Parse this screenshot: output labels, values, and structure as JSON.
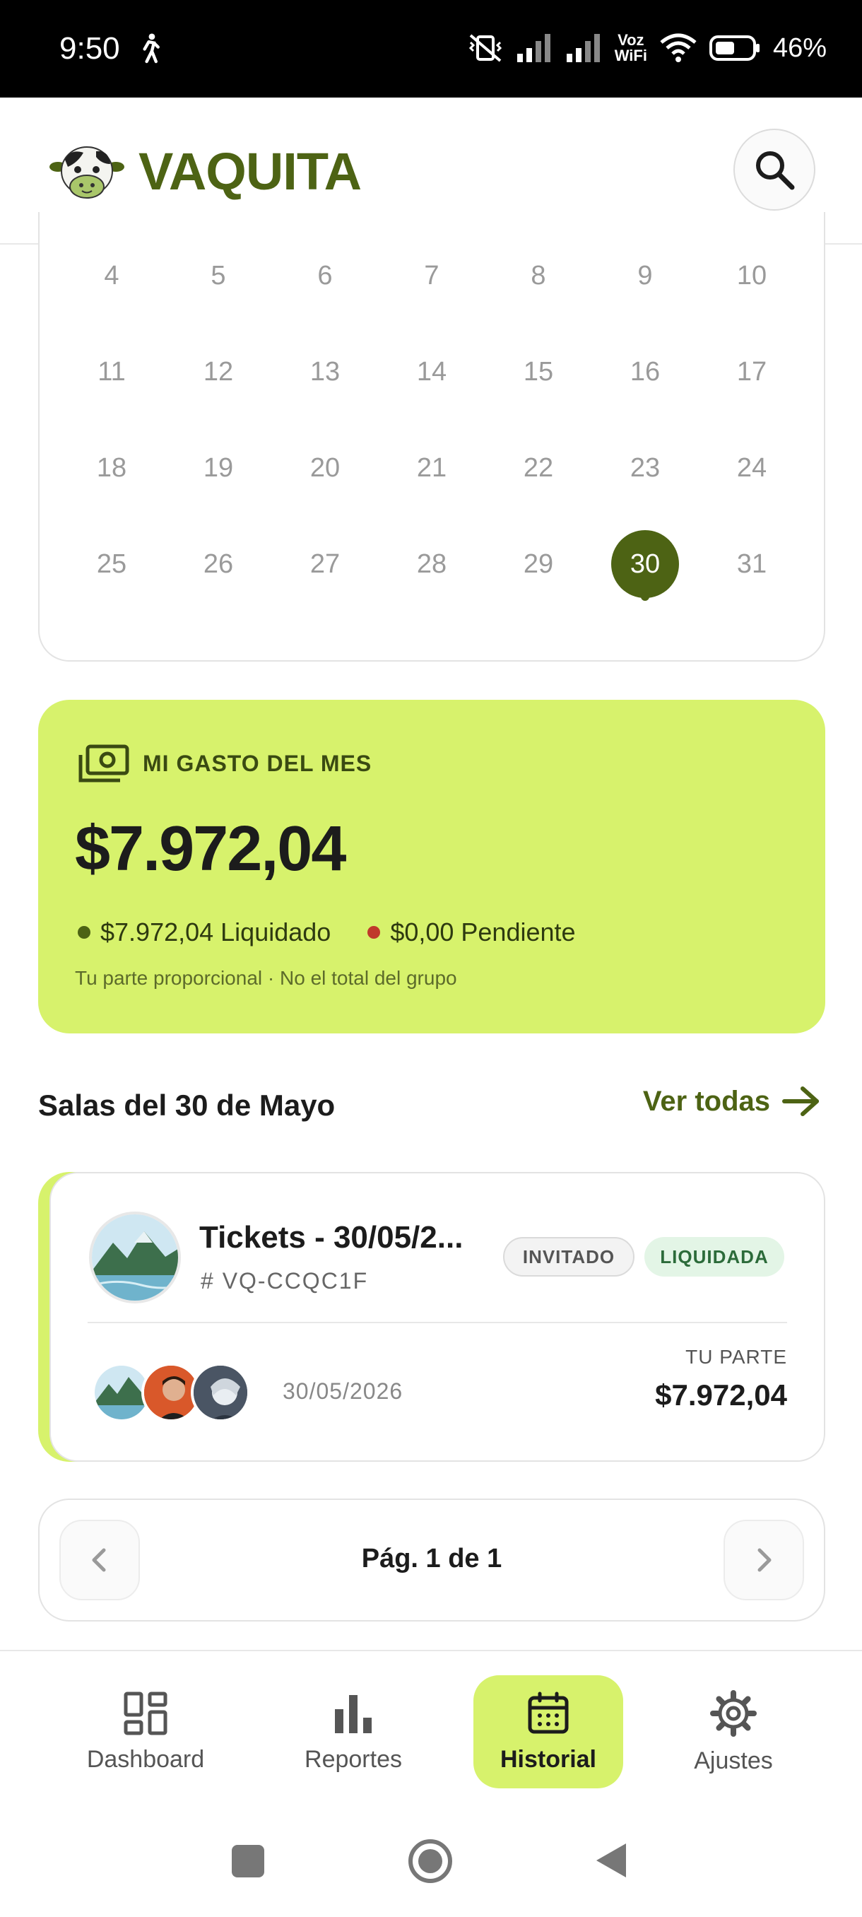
{
  "status_bar": {
    "time": "9:50",
    "network_label_top": "Voz",
    "network_label_bottom": "WiFi",
    "battery": "46%"
  },
  "app": {
    "name": "VAQUITA",
    "brand_color": "#4d6314",
    "accent_color": "#d7f26c"
  },
  "calendar": {
    "rows": [
      [
        "4",
        "5",
        "6",
        "7",
        "8",
        "9",
        "10"
      ],
      [
        "11",
        "12",
        "13",
        "14",
        "15",
        "16",
        "17"
      ],
      [
        "18",
        "19",
        "20",
        "21",
        "22",
        "23",
        "24"
      ],
      [
        "25",
        "26",
        "27",
        "28",
        "29",
        "30",
        "31"
      ]
    ],
    "selected_day": "30"
  },
  "month_spend": {
    "label": "MI GASTO DEL MES",
    "amount": "$7.972,04",
    "settled": "$7.972,04 Liquidado",
    "pending": "$0,00 Pendiente",
    "note": "Tu parte proporcional · No el total del grupo",
    "settled_color": "#4d6314",
    "pending_color": "#c0392b"
  },
  "section": {
    "title": "Salas del 30 de Mayo",
    "see_all": "Ver todas"
  },
  "room": {
    "name": "Tickets - 30/05/2...",
    "code": "# VQ-CCQC1F",
    "badge_role": "INVITADO",
    "badge_status": "LIQUIDADA",
    "date": "30/05/2026",
    "share_label": "TU PARTE",
    "share_amount": "$7.972,04"
  },
  "pagination": {
    "text": "Pág. 1 de 1"
  },
  "bottom_nav": {
    "items": [
      {
        "label": "Dashboard",
        "icon": "dashboard-icon"
      },
      {
        "label": "Reportes",
        "icon": "bar-chart-icon"
      },
      {
        "label": "Historial",
        "icon": "calendar-icon"
      },
      {
        "label": "Ajustes",
        "icon": "gear-icon"
      }
    ],
    "active": "Historial"
  }
}
